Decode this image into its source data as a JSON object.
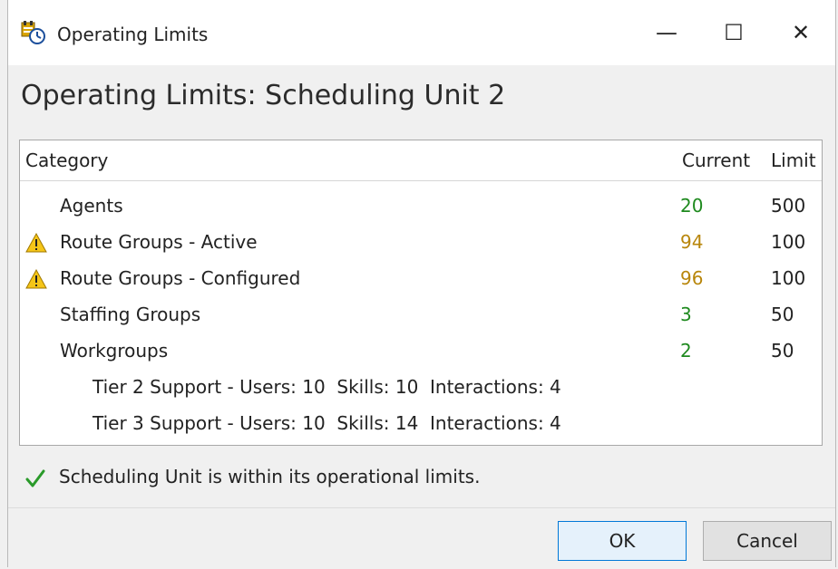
{
  "window": {
    "title": "Operating Limits",
    "controls": {
      "minimize": "—",
      "maximize": "☐",
      "close": "✕"
    }
  },
  "heading": "Operating Limits: Scheduling Unit 2",
  "table": {
    "headers": {
      "category": "Category",
      "current": "Current",
      "limit": "Limit"
    },
    "rows": [
      {
        "name": "Agents",
        "current": "20",
        "limit": "500",
        "warning": false,
        "current_color": "#1f8a1f"
      },
      {
        "name": "Route Groups - Active",
        "current": "94",
        "limit": "100",
        "warning": true,
        "current_color": "#b8860b"
      },
      {
        "name": "Route Groups - Configured",
        "current": "96",
        "limit": "100",
        "warning": true,
        "current_color": "#b8860b"
      },
      {
        "name": "Staffing Groups",
        "current": "3",
        "limit": "50",
        "warning": false,
        "current_color": "#1f8a1f"
      },
      {
        "name": "Workgroups",
        "current": "2",
        "limit": "50",
        "warning": false,
        "current_color": "#1f8a1f"
      }
    ],
    "subrows": [
      "Tier 2 Support - Users: 10  Skills: 10  Interactions: 4",
      "Tier 3 Support - Users: 10  Skills: 14  Interactions: 4"
    ]
  },
  "status": {
    "text": "Scheduling Unit is within its operational limits.",
    "icon": "check-icon"
  },
  "buttons": {
    "ok": "OK",
    "cancel": "Cancel"
  }
}
